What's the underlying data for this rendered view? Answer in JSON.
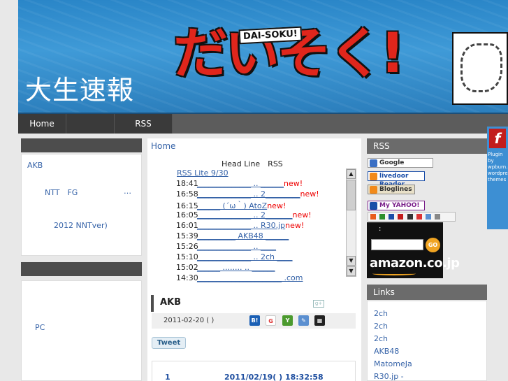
{
  "banner": {
    "site_title": "大生速報",
    "logo_main": "だいそく!",
    "logo_sub": "DAI-SOKU!"
  },
  "nav": {
    "items": [
      "Home",
      "",
      "RSS"
    ]
  },
  "flash": {
    "text": "Plugin by wpburn.com wordpress themes"
  },
  "left": {
    "item_akb": "AKB",
    "item_ntt": "NTT　FG",
    "item_ellipsis": "…",
    "item_2012": "2012 NNTver)",
    "item_pc": "PC"
  },
  "main": {
    "home": "Home",
    "feed": {
      "title": "Head Line　RSS",
      "lite": "RSS Lite  9/30",
      "rows": [
        {
          "time": "18:41",
          "link": "______________ ..    ______",
          "new": "new!"
        },
        {
          "time": "16:58",
          "link": "______________ ..    2_________",
          "new": "new!"
        },
        {
          "time": "16:15",
          "link": "______ (´ω｀)   AtoZ",
          "new": "new!"
        },
        {
          "time": "16:05",
          "link": "______________ ..    2_______",
          "new": "new!"
        },
        {
          "time": "16:01",
          "link": "______________ ..    R30.jp",
          "new": "new!"
        },
        {
          "time": "15:39",
          "link": "__________    AKB48 ______",
          "new": ""
        },
        {
          "time": "15:26",
          "link": "______________ ..    ____",
          "new": ""
        },
        {
          "time": "15:10",
          "link": "______________ ..    2ch ____",
          "new": ""
        },
        {
          "time": "15:02",
          "link": "______ ........    ..    ______",
          "new": ""
        },
        {
          "time": "14:30",
          "link": "______________________ .com",
          "new": ""
        }
      ]
    },
    "post": {
      "title": "AKB",
      "gplus": "g+",
      "date": "2011-02-20 (   )",
      "share_buttons": [
        "B!",
        "G",
        "Y",
        "✎",
        "▦"
      ],
      "tweet": "Tweet",
      "num": "1",
      "stamp": "2011/02/19(   ) 18:32:58"
    }
  },
  "right": {
    "rss_head": "RSS",
    "google": "Google",
    "livedoor": "livedoor Reader",
    "bloglines": "Bloglines",
    "myyahoo": "My YAHOO!",
    "search_label": ":",
    "search_placeholder": "",
    "go": "GO",
    "amazon": "amazon.co.jp",
    "links_head": "Links",
    "links": [
      "2ch",
      "2ch",
      "2ch",
      "AKB48",
      "MatomeJa",
      "R30.jp -"
    ],
    "colors": {
      "accent_blue": "#3663a8",
      "new_red": "#ee0000"
    }
  }
}
